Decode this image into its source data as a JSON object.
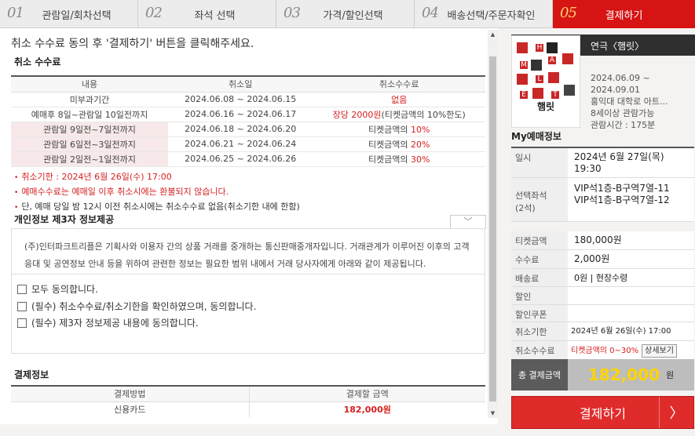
{
  "steps": [
    {
      "num": "01",
      "label": "관람일/회차선택"
    },
    {
      "num": "02",
      "label": "좌석 선택"
    },
    {
      "num": "03",
      "label": "가격/할인선택"
    },
    {
      "num": "04",
      "label": "배송선택/주문자확인"
    },
    {
      "num": "05",
      "label": "결제하기"
    }
  ],
  "notice": "취소 수수료 동의 후 '결제하기' 버튼을 클릭해주세요.",
  "cancel_fee": {
    "title": "취소 수수료",
    "headers": [
      "내용",
      "취소일",
      "취소수수료"
    ],
    "rows": [
      {
        "content": "미부과기간",
        "period": "2024.06.08 ~ 2024.06.15",
        "fee": "없음",
        "fee_pre": "",
        "fee_post": ""
      },
      {
        "content": "예매후 8일~관람일 10일전까지",
        "period": "2024.06.16 ~ 2024.06.17",
        "fee": "장당 2000원",
        "fee_pre": "",
        "fee_post": "(티켓금액의 10%한도)"
      },
      {
        "content": "관람일 9일전~7일전까지",
        "period": "2024.06.18 ~ 2024.06.20",
        "fee": "10%",
        "fee_pre": "티켓금액의 ",
        "fee_post": ""
      },
      {
        "content": "관람일 6일전~3일전까지",
        "period": "2024.06.21 ~ 2024.06.24",
        "fee": "20%",
        "fee_pre": "티켓금액의 ",
        "fee_post": ""
      },
      {
        "content": "관람일 2일전~1일전까지",
        "period": "2024.06.25 ~ 2024.06.26",
        "fee": "30%",
        "fee_pre": "티켓금액의 ",
        "fee_post": ""
      }
    ],
    "notes": [
      "취소기한 : 2024년 6월 26일(수) 17:00",
      "예매수수료는 예매일 이후 취소시에는 환불되지 않습니다.",
      "단, 예매 당일 밤 12시 이전 취소시에는 취소수수료 없음(취소기한 내에 한함)"
    ]
  },
  "privacy": {
    "title": "개인정보 제3자 정보제공",
    "text": "(주)인터파크트리플은 기획사와 이용자 간의 상품 거래를 중개하는 통신판매중개자입니다. 거래관계가 이루어진 이후의 고객응대 및 공연정보 안내 등을 위하여 관련한 정보는 필요한 범위 내에서 거래 당사자에게 아래와 같이 제공됩니다."
  },
  "agreements": [
    "모두 동의합니다.",
    "(필수) 취소수수료/취소기한을 확인하였으며, 동의합니다.",
    "(필수) 제3자 정보제공 내용에 동의합니다."
  ],
  "payment": {
    "title": "결제정보",
    "headers": [
      "결제방법",
      "결제할 금액"
    ],
    "method": "신용카드",
    "amount": "182,000원"
  },
  "show": {
    "title": "연극〈햄릿〉",
    "dates": "2024.06.09 ~\n2024.09.01",
    "venue": "홍익대 대학로 아트...",
    "age": "8세이상 관람가능",
    "runtime": "관람시간 : 175분",
    "poster_text": "햄릿",
    "poster_letters": [
      "H",
      "A",
      "M",
      "L",
      "E",
      "T"
    ]
  },
  "my": {
    "title": "My예매정보",
    "rows": [
      {
        "k": "일시",
        "v": "2024년 6월 27일(목)\n19:30"
      },
      {
        "k": "선택좌석\n(2석)",
        "v": "VIP석1층-B구역7열-11\nVIP석1층-B구역7열-12"
      },
      {
        "k": "티켓금액",
        "v": "180,000원"
      },
      {
        "k": "수수료",
        "v": "2,000원"
      },
      {
        "k": "배송료",
        "v": "0원 | 현장수령"
      },
      {
        "k": "할인",
        "v": ""
      },
      {
        "k": "할인쿠폰",
        "v": ""
      },
      {
        "k": "취소기한",
        "v": "2024년 6월 26일(수) 17:00"
      },
      {
        "k": "취소수수료",
        "v": "티켓금액의 0~30%"
      }
    ],
    "detail_btn": "상세보기",
    "total_label": "총 결제금액",
    "total_amount": "182,000",
    "total_unit": "원",
    "pay_button": "결제하기",
    "pay_arrow": "〉"
  },
  "colors": {
    "accent": "#d61414",
    "fee_red": "#d62020",
    "total_yellow": "#ffd400"
  }
}
